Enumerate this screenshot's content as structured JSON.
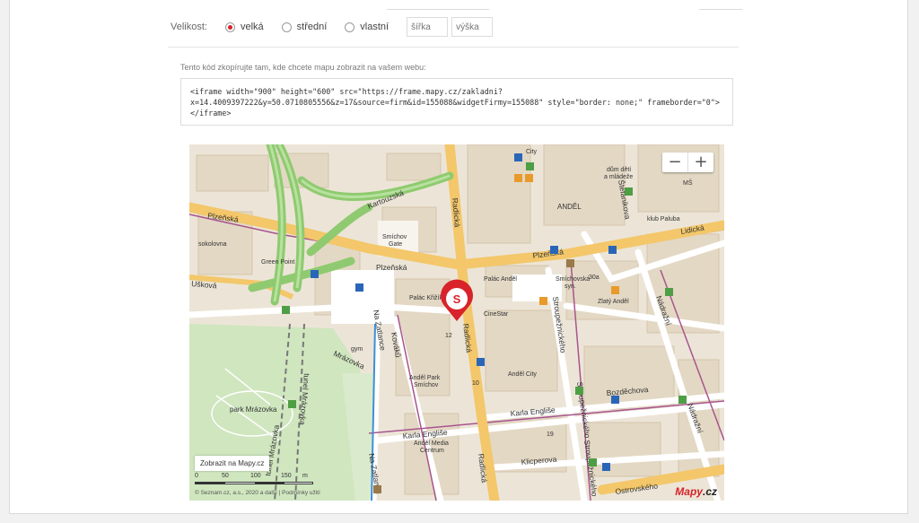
{
  "size": {
    "label": "Velikost:",
    "options": [
      {
        "label": "velká",
        "selected": true
      },
      {
        "label": "střední",
        "selected": false
      },
      {
        "label": "vlastní",
        "selected": false
      }
    ],
    "width_placeholder": "šířka",
    "height_placeholder": "výška"
  },
  "embed": {
    "hint": "Tento kód zkopírujte tam, kde chcete mapu zobrazit na vašem webu:",
    "code": "<iframe width=\"900\" height=\"600\" src=\"https://frame.mapy.cz/zakladni?\nx=14.4009397222&y=50.0710805556&z=17&source=firm&id=155088&widgetFirmy=155088\" style=\"border: none;\" frameborder=\"0\">\n</iframe>"
  },
  "map": {
    "zoom_out": "−",
    "zoom_in": "+",
    "show_link": "Zobrazit na Mapy.cz",
    "scale_labels": [
      "0",
      "50",
      "100",
      "150"
    ],
    "scale_unit": "m",
    "copyright": "© Seznam.cz, a.s., 2020 a další | Podmínky užití",
    "brand_red": "Mapy",
    "brand_dark": ".cz",
    "marker_icon": "map-pin-icon",
    "marker_color": "#d8232a",
    "streets": [
      "Kartouzská",
      "Plzeňská",
      "Plzeňská",
      "Radlická",
      "Radlická",
      "Radlická",
      "Štefánikova",
      "Lidická",
      "Plzeňská",
      "Nádražní",
      "Nádražní",
      "Mrázovka",
      "tunel Mrázovka",
      "tunel Mrázovka",
      "Kováků",
      "Na Zatlance",
      "Na Zatlance",
      "Karla Engliše",
      "Karla Engliše",
      "Stroupežnického",
      "Stroupežnického",
      "Stroupežnického",
      "Klicperova",
      "Ostrovského",
      "Bozděchova",
      "Ušková"
    ],
    "places": [
      "City",
      "Anděl",
      "Smíchov Gate",
      "Green Point",
      "sokolovna",
      "Palác Křižík",
      "Palác Anděl",
      "CineStar",
      "Smíchovská syn.",
      "Zlatý Anděl",
      "Anděl City",
      "Anděl Park Smíchov",
      "Anděl Media Centrum",
      "park Mrázovka",
      "klub Paluba",
      "dům dětí a mládeže",
      "MŠ",
      "gym",
      "30a",
      "12",
      "10",
      "19"
    ]
  }
}
